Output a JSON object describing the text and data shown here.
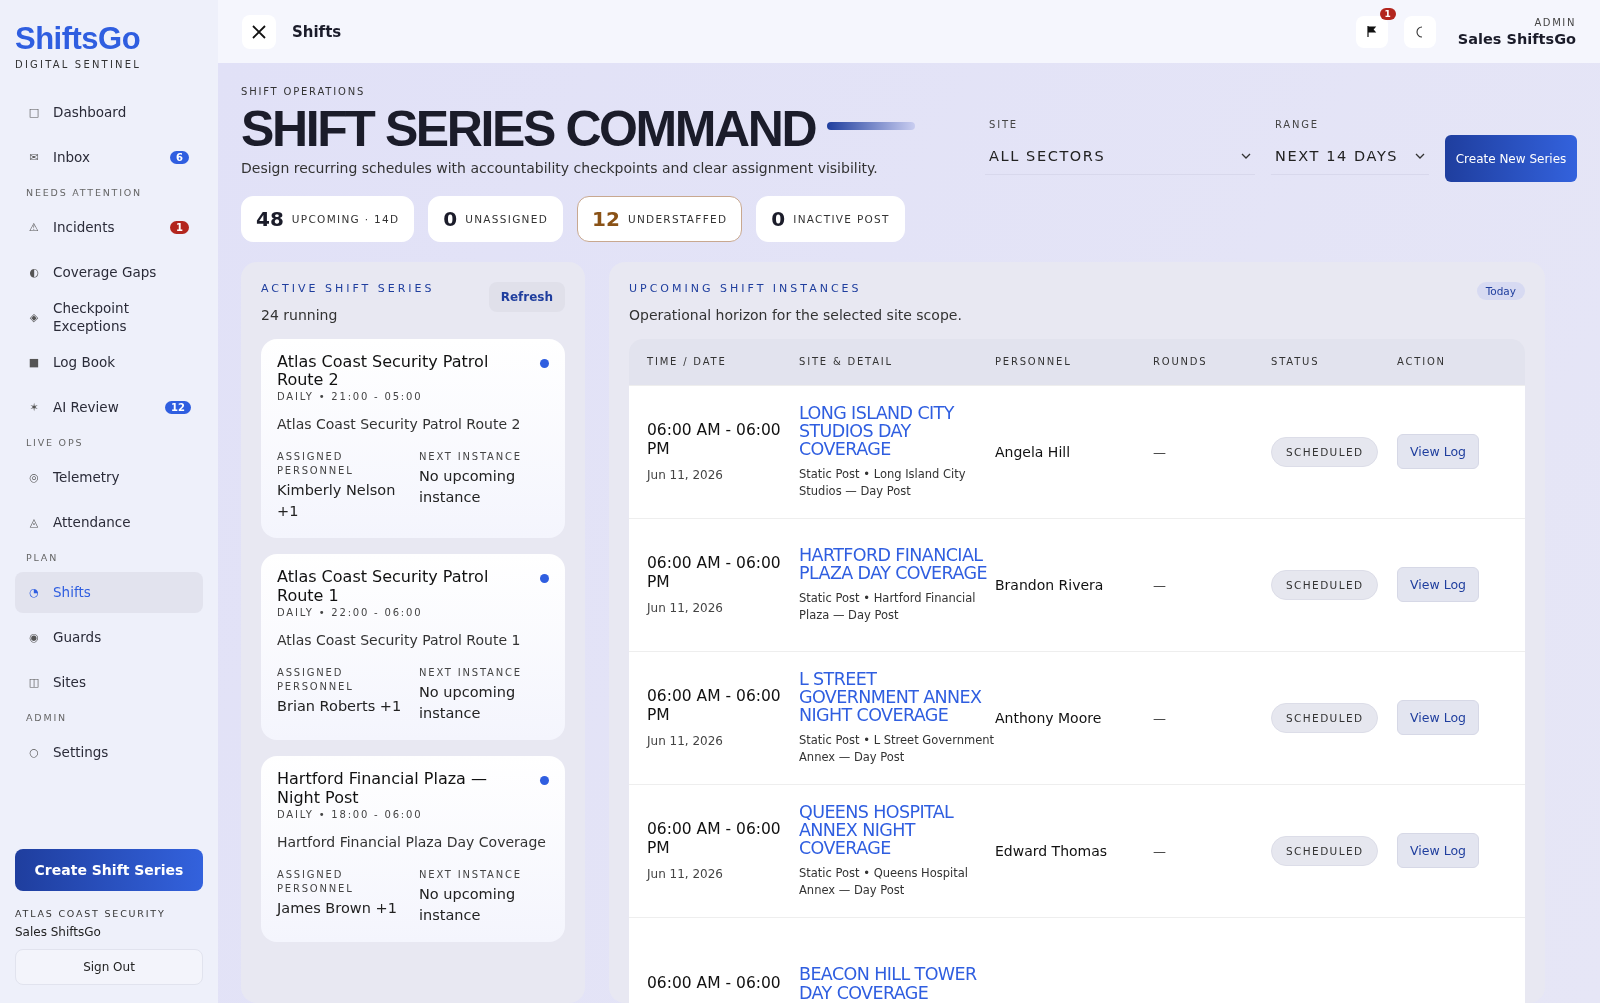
{
  "brand": {
    "name": "ShiftsGo",
    "tagline": "DIGITAL SENTINEL"
  },
  "sidebar": {
    "groups": [
      {
        "items": [
          {
            "icon": "□",
            "label": "Dashboard",
            "selected": false
          },
          {
            "icon": "✉",
            "label": "Inbox",
            "selected": false,
            "badge": "6",
            "color": "#2f5ee0"
          }
        ]
      },
      {
        "heading": "NEEDS ATTENTION",
        "items": [
          {
            "icon": "⚠",
            "label": "Incidents",
            "selected": false,
            "badge": "1",
            "color": "#b3261e"
          },
          {
            "icon": "◐",
            "label": "Coverage Gaps",
            "selected": false
          },
          {
            "icon": "◈",
            "label": "Checkpoint Exceptions",
            "selected": false
          },
          {
            "icon": "■",
            "label": "Log Book",
            "selected": false
          },
          {
            "icon": "✶",
            "label": "AI Review",
            "selected": false,
            "badge": "12",
            "color": "#2f5ee0"
          }
        ]
      },
      {
        "heading": "LIVE OPS",
        "items": [
          {
            "icon": "◎",
            "label": "Telemetry",
            "selected": false
          },
          {
            "icon": "◬",
            "label": "Attendance",
            "selected": false
          }
        ]
      },
      {
        "heading": "PLAN",
        "items": [
          {
            "icon": "◔",
            "label": "Shifts",
            "selected": true
          },
          {
            "icon": "◉",
            "label": "Guards",
            "selected": false
          },
          {
            "icon": "◫",
            "label": "Sites",
            "selected": false
          }
        ]
      },
      {
        "heading": "ADMIN",
        "items": [
          {
            "icon": "○",
            "label": "Settings",
            "selected": false
          }
        ]
      }
    ],
    "create_button": "Create Shift Series",
    "org": "ATLAS COAST SECURITY",
    "user": "Sales ShiftsGo",
    "sign_out": "Sign Out"
  },
  "topbar": {
    "title": "Shifts",
    "alert_count": "1",
    "role": "ADMIN",
    "user": "Sales ShiftsGo"
  },
  "hero": {
    "eyebrow": "SHIFT OPERATIONS",
    "title": "SHIFT SERIES COMMAND",
    "subtitle": "Design recurring schedules with accountability checkpoints and clear assignment visibility.",
    "site": {
      "label": "SITE",
      "value": "ALL SECTORS"
    },
    "range": {
      "label": "RANGE",
      "value": "NEXT 14 DAYS"
    },
    "create_button": "Create New Series"
  },
  "stats": [
    {
      "value": "48",
      "label": "UPCOMING · 14D",
      "highlighted": false
    },
    {
      "value": "0",
      "label": "UNASSIGNED",
      "highlighted": false
    },
    {
      "value": "12",
      "label": "UNDERSTAFFED",
      "highlighted": true
    },
    {
      "value": "0",
      "label": "INACTIVE POST",
      "highlighted": false
    }
  ],
  "series_panel": {
    "title": "ACTIVE SHIFT SERIES",
    "count": "24 running",
    "refresh": "Refresh",
    "cards": [
      {
        "name": "Atlas Coast Security Patrol Route 2",
        "schedule": "DAILY • 21:00 - 05:00",
        "route": "Atlas Coast Security Patrol Route 2",
        "assigned_label": "ASSIGNED PERSONNEL",
        "next_label": "NEXT INSTANCE",
        "personnel": "Kimberly Nelson +1",
        "next": "No upcoming instance",
        "color": "#2f5ee0"
      },
      {
        "name": "Atlas Coast Security Patrol Route 1",
        "schedule": "DAILY • 22:00 - 06:00",
        "route": "Atlas Coast Security Patrol Route 1",
        "assigned_label": "ASSIGNED PERSONNEL",
        "next_label": "NEXT INSTANCE",
        "personnel": "Brian Roberts +1",
        "next": "No upcoming instance",
        "color": "#2f5ee0"
      },
      {
        "name": "Hartford Financial Plaza — Night Post",
        "schedule": "DAILY • 18:00 - 06:00",
        "route": "Hartford Financial Plaza Day Coverage",
        "assigned_label": "ASSIGNED PERSONNEL",
        "next_label": "NEXT INSTANCE",
        "personnel": "James Brown +1",
        "next": "No upcoming instance",
        "color": "#2f5ee0"
      }
    ]
  },
  "instances_panel": {
    "title": "UPCOMING SHIFT INSTANCES",
    "subtitle": "Operational horizon for the selected site scope.",
    "today": "Today",
    "columns": [
      "TIME / DATE",
      "SITE & DETAIL",
      "PERSONNEL",
      "ROUNDS",
      "STATUS",
      "ACTION"
    ],
    "rows": [
      {
        "time": "06:00 AM - 06:00 PM",
        "date": "Jun 11, 2026",
        "site": "LONG ISLAND CITY STUDIOS DAY COVERAGE",
        "detail": "Static Post • Long Island City Studios — Day Post",
        "personnel": "Angela Hill",
        "rounds": "—",
        "status": "SCHEDULED",
        "action": "View Log"
      },
      {
        "time": "06:00 AM - 06:00 PM",
        "date": "Jun 11, 2026",
        "site": "HARTFORD FINANCIAL PLAZA DAY COVERAGE",
        "detail": "Static Post • Hartford Financial Plaza — Day Post",
        "personnel": "Brandon Rivera",
        "rounds": "—",
        "status": "SCHEDULED",
        "action": "View Log"
      },
      {
        "time": "06:00 AM - 06:00 PM",
        "date": "Jun 11, 2026",
        "site": "L STREET GOVERNMENT ANNEX NIGHT COVERAGE",
        "detail": "Static Post • L Street Government Annex — Day Post",
        "personnel": "Anthony Moore",
        "rounds": "—",
        "status": "SCHEDULED",
        "action": "View Log"
      },
      {
        "time": "06:00 AM - 06:00 PM",
        "date": "Jun 11, 2026",
        "site": "QUEENS HOSPITAL ANNEX NIGHT COVERAGE",
        "detail": "Static Post • Queens Hospital Annex — Day Post",
        "personnel": "Edward Thomas",
        "rounds": "—",
        "status": "SCHEDULED",
        "action": "View Log"
      },
      {
        "time": "06:00 AM - 06:00",
        "site": "BEACON HILL TOWER DAY COVERAGE"
      }
    ]
  }
}
